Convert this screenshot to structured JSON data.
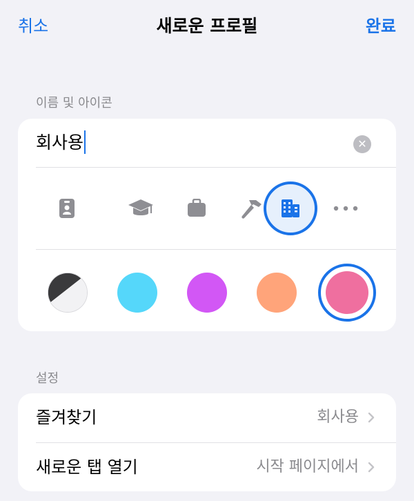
{
  "nav": {
    "cancel_label": "취소",
    "title": "새로운 프로필",
    "done_label": "완료"
  },
  "sections": {
    "name_icon_label": "이름 및 아이콘",
    "settings_label": "설정"
  },
  "profile": {
    "name_value": "회사용"
  },
  "icons": [
    {
      "name": "id-badge-icon",
      "selected": false
    },
    {
      "name": "graduation-cap-icon",
      "selected": false
    },
    {
      "name": "briefcase-icon",
      "selected": false
    },
    {
      "name": "hammer-icon",
      "selected": false
    },
    {
      "name": "building-icon",
      "selected": true
    },
    {
      "name": "more-icon",
      "selected": false
    }
  ],
  "colors": [
    {
      "name": "black-white",
      "hex": "#3a3a3c",
      "selected": false
    },
    {
      "name": "cyan",
      "hex": "#55d7fa",
      "selected": false
    },
    {
      "name": "purple",
      "hex": "#d257f5",
      "selected": false
    },
    {
      "name": "orange",
      "hex": "#ffa47a",
      "selected": false
    },
    {
      "name": "pink",
      "hex": "#ef6f9f",
      "selected": true
    }
  ],
  "accent_color": "#1a73e8",
  "settings": [
    {
      "label": "즐겨찾기",
      "value": "회사용"
    },
    {
      "label": "새로운 탭 열기",
      "value": "시작 페이지에서"
    }
  ]
}
